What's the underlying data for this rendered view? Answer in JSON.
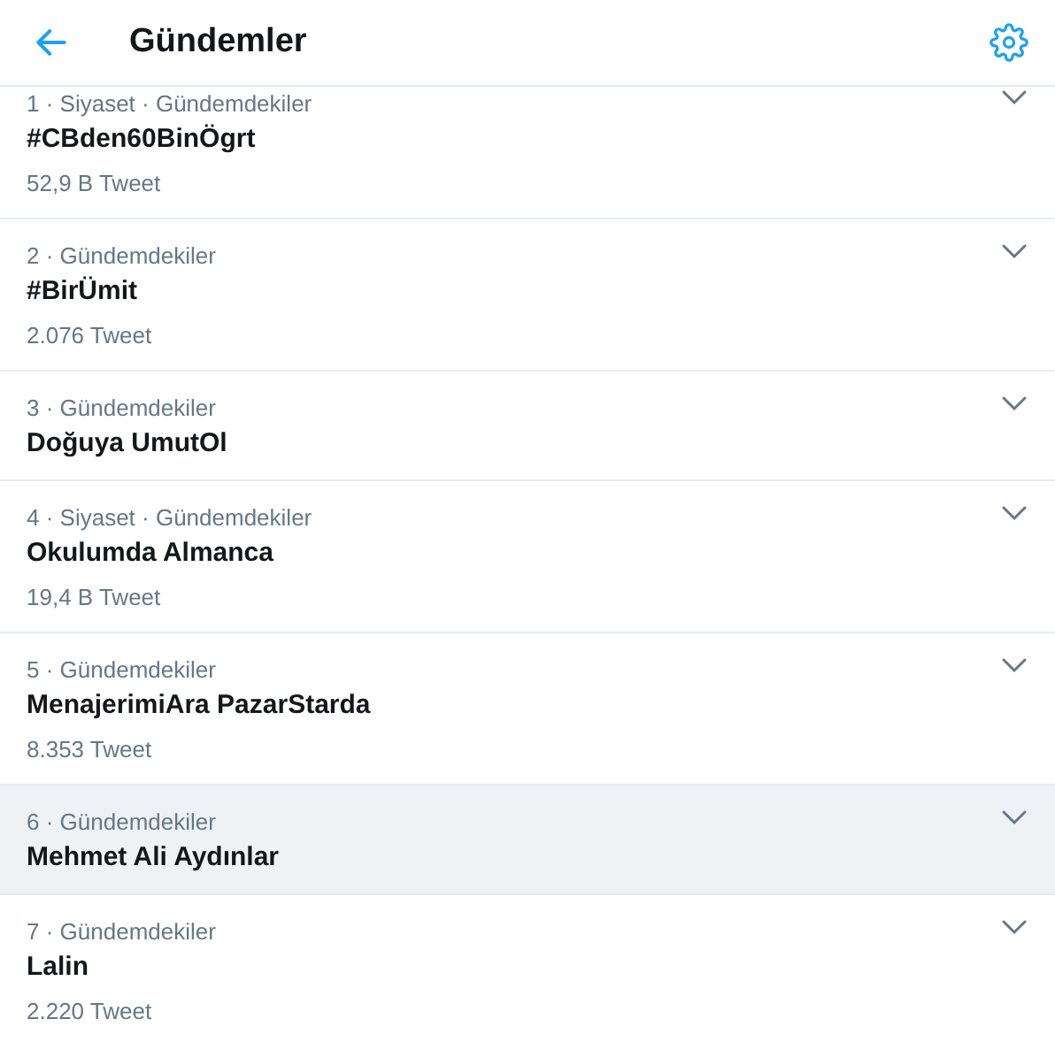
{
  "header": {
    "title": "Gündemler"
  },
  "trends": [
    {
      "context": "1 · Siyaset · Gündemdekiler",
      "name": "#CBden60BinÖgrt",
      "count": "52,9 B Tweet",
      "hovered": false
    },
    {
      "context": "2 · Gündemdekiler",
      "name": "#BirÜmit",
      "count": "2.076 Tweet",
      "hovered": false
    },
    {
      "context": "3 · Gündemdekiler",
      "name": "Doğuya UmutOl",
      "hovered": false
    },
    {
      "context": "4 · Siyaset · Gündemdekiler",
      "name": "Okulumda Almanca",
      "count": "19,4 B Tweet",
      "hovered": false
    },
    {
      "context": "5 · Gündemdekiler",
      "name": "MenajerimiAra PazarStarda",
      "count": "8.353 Tweet",
      "hovered": false
    },
    {
      "context": "6 · Gündemdekiler",
      "name": "Mehmet Ali Aydınlar",
      "hovered": true
    },
    {
      "context": "7 · Gündemdekiler",
      "name": "Lalin",
      "count": "2.220 Tweet",
      "hovered": false
    }
  ]
}
